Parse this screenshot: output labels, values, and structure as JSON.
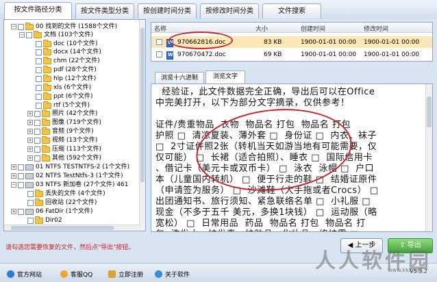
{
  "tabs": [
    {
      "label": "按文件路径分类",
      "active": true
    },
    {
      "label": "按文件类型分类",
      "active": false
    },
    {
      "label": "按创建时间分类",
      "active": false
    },
    {
      "label": "按修改时间分类",
      "active": false
    },
    {
      "label": "文件搜索",
      "active": false
    }
  ],
  "tree": [
    {
      "exp": "−",
      "label": "00  找到的文件 (1588个文件)",
      "icon": "folder"
    },
    {
      "exp": "−",
      "label": "文档 (103个文件)",
      "icon": "folder"
    },
    {
      "exp": "",
      "label": "doc   (10个文件)",
      "icon": "folder"
    },
    {
      "exp": "",
      "label": "docx   (14个文件)",
      "icon": "folder"
    },
    {
      "exp": "",
      "label": "chm   (22个文件)",
      "icon": "folder"
    },
    {
      "exp": "",
      "label": "pdf   (28个文件)",
      "icon": "folder"
    },
    {
      "exp": "",
      "label": "hlp   (12个文件)",
      "icon": "folder"
    },
    {
      "exp": "",
      "label": "xls   (6个文件)",
      "icon": "folder"
    },
    {
      "exp": "",
      "label": "ppt   (6个文件)",
      "icon": "folder"
    },
    {
      "exp": "",
      "label": "rtf   (5个文件)",
      "icon": "folder"
    },
    {
      "exp": "+",
      "label": "照片 (42个文件)",
      "icon": "folder"
    },
    {
      "exp": "+",
      "label": "图像 (719个文件)",
      "icon": "folder"
    },
    {
      "exp": "+",
      "label": "音频 (9个文件)",
      "icon": "folder"
    },
    {
      "exp": "+",
      "label": "视频 (13个文件)",
      "icon": "folder"
    },
    {
      "exp": "+",
      "label": "压缩 (113个文件)",
      "icon": "folder"
    },
    {
      "exp": "+",
      "label": "其他 (592个文件)",
      "icon": "folder"
    },
    {
      "exp": "+",
      "label": "01  NTFS TESTNTFS-2  (1个文件)",
      "icon": "drive"
    },
    {
      "exp": "+",
      "label": "02  NTFS TestNtfs-3   (1个文件)",
      "icon": "drive"
    },
    {
      "exp": "−",
      "label": "03  NTFS 新加卷   (27个文件)  461",
      "icon": "drive"
    },
    {
      "exp": "",
      "label": "丢失的文件   (4个文件)",
      "icon": "folder"
    },
    {
      "exp": "",
      "label": "回收站   (22个文件)",
      "icon": "folder"
    },
    {
      "exp": "+",
      "label": "06  FatDir   (1个文件)",
      "icon": "drive"
    },
    {
      "exp": "",
      "label": "Dir02",
      "icon": "folder"
    }
  ],
  "filelist": {
    "columns": [
      "名称",
      "大小",
      "创建时间",
      "修改时间"
    ],
    "rows": [
      {
        "name": "970662816.doc",
        "size": "83 KB",
        "created": "1900-01-01 00:00",
        "modified": "1900-01-01 00:00",
        "selected": true
      },
      {
        "name": "970670472.doc",
        "size": "69 KB",
        "created": "1900-01-01 00:00",
        "modified": "1900-01-01 00:00",
        "selected": false
      }
    ]
  },
  "preview_tabs": [
    {
      "label": "浏览十六进制",
      "active": false
    },
    {
      "label": "浏览文字",
      "active": true
    }
  ],
  "preview_lines": [
    "  经验证，此文件数据完全正确，导出后可以在Office",
    "中完美打开，以下为部分文字摘录，仅供参考！",
    "",
    "证件/贵重物品  衣物  物品名 打包  物品名 打包",
    "护照 □  清凉夏装、薄外套 □  身份证 □  内衣、袜子",
    "□  2寸证件照2张（转机当天如游当地有可能需要，仅",
    "仅可能） □  长裙（适合拍照）、睡衣 □  国际信用卡",
    "、借记卡（美元卡或双币卡） □  泳衣  泳帽 □  户口",
    "本（儿童国内转机） □  便于行走的鞋 □  结婚证原件",
    "（申请签为服务） □  沙滩鞋（大手拖或者Crocs） □",
    "出团通知书、旅行须知、紧急联络名单 □  小礼服 □",
    "现金（不多于五千 美元，多换1块钱） □  运动服（略",
    "宽松） □  日常用品  药品  物品名 打包  物品名 打",
    "包  洗发水、护发素、护肤品、化妆品、修护霜 □"
  ],
  "hint": "请勾选您需要恢复的文件，然后点\"导出\"按钮。",
  "buttons": {
    "prev": "上一步",
    "export": "导出"
  },
  "footer_links": [
    {
      "label": "官方网站",
      "icon": "ie-icon",
      "color": "#2f7bd3"
    },
    {
      "label": "客服QQ",
      "icon": "qq-icon",
      "color": "#f1a23a"
    },
    {
      "label": "立即注册",
      "icon": "key-icon",
      "color": "#d9a13c"
    },
    {
      "label": "关于软件",
      "icon": "info-icon",
      "color": "#3c8bd9"
    }
  ],
  "watermark": "人人软件园",
  "watermark_url": "www.kkx.net",
  "version": "V5.3.2",
  "colors": {
    "accent_red": "#c8232b",
    "selected_row": "#fbe6b8",
    "export_green": "#43a33a"
  }
}
